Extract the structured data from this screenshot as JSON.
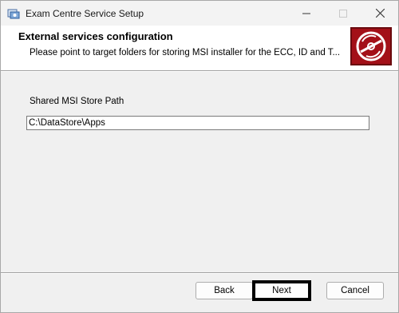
{
  "window": {
    "title": "Exam Centre Service Setup",
    "icon": "installer-icon"
  },
  "banner": {
    "title": "External services configuration",
    "description": "Please point to target folders for storing MSI installer for the ECC, ID and T...",
    "logo": "disc-logo-icon",
    "logo_color": "#a31018"
  },
  "form": {
    "label": "Shared MSI Store Path",
    "value": "C:\\DataStore\\Apps"
  },
  "buttons": {
    "back": "Back",
    "next": "Next",
    "cancel": "Cancel"
  }
}
